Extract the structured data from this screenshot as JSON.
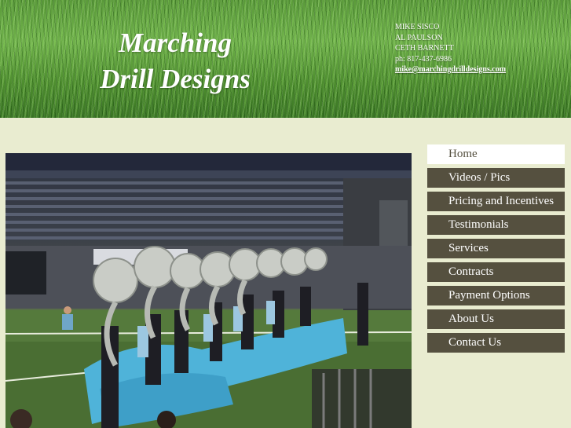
{
  "header": {
    "logo_line1": "Marching",
    "logo_line2": "Drill Designs",
    "contacts": [
      "MIKE SISCO",
      "AL PAULSON",
      "CETH BARNETT",
      "ph: 817-437-6986"
    ],
    "email": "mike@marchingdrilldesigns.com"
  },
  "nav": {
    "items": [
      {
        "label": "Home",
        "active": true
      },
      {
        "label": "Videos / Pics"
      },
      {
        "label": "Pricing and Incentives"
      },
      {
        "label": "Testimonials"
      },
      {
        "label": "Services"
      },
      {
        "label": "Contracts"
      },
      {
        "label": "Payment Options"
      },
      {
        "label": "About Us"
      },
      {
        "label": "Contact Us"
      }
    ]
  },
  "colors": {
    "page_bg": "#e9ecd0",
    "nav_bg": "#55503f",
    "nav_active_bg": "#ffffff",
    "grass": "#5a9a3a",
    "flag_blue": "#4fb3d9"
  }
}
